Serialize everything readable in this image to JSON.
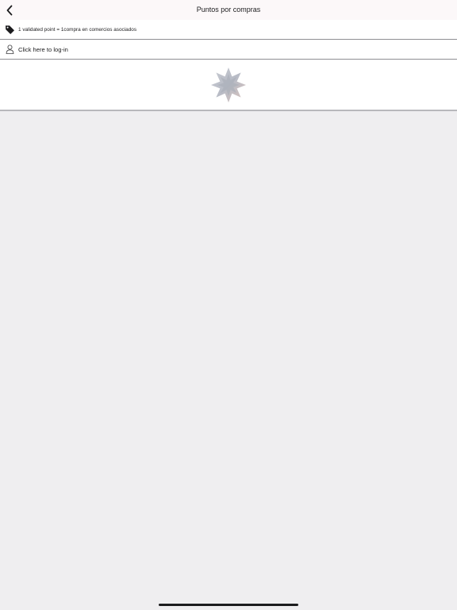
{
  "nav": {
    "title": "Puntos por compras"
  },
  "info_row": {
    "text": "1 validated point = 1compra en comercios asociados",
    "icon": "tag-icon"
  },
  "login_row": {
    "text": "Click here to log-in",
    "icon": "user-icon"
  },
  "banner": {
    "icon": "star-burst-logo"
  },
  "colors": {
    "nav_background": "#fcf8f9",
    "page_background": "#efeef0",
    "row_background": "#ffffff",
    "separator": "#8e8e93"
  }
}
